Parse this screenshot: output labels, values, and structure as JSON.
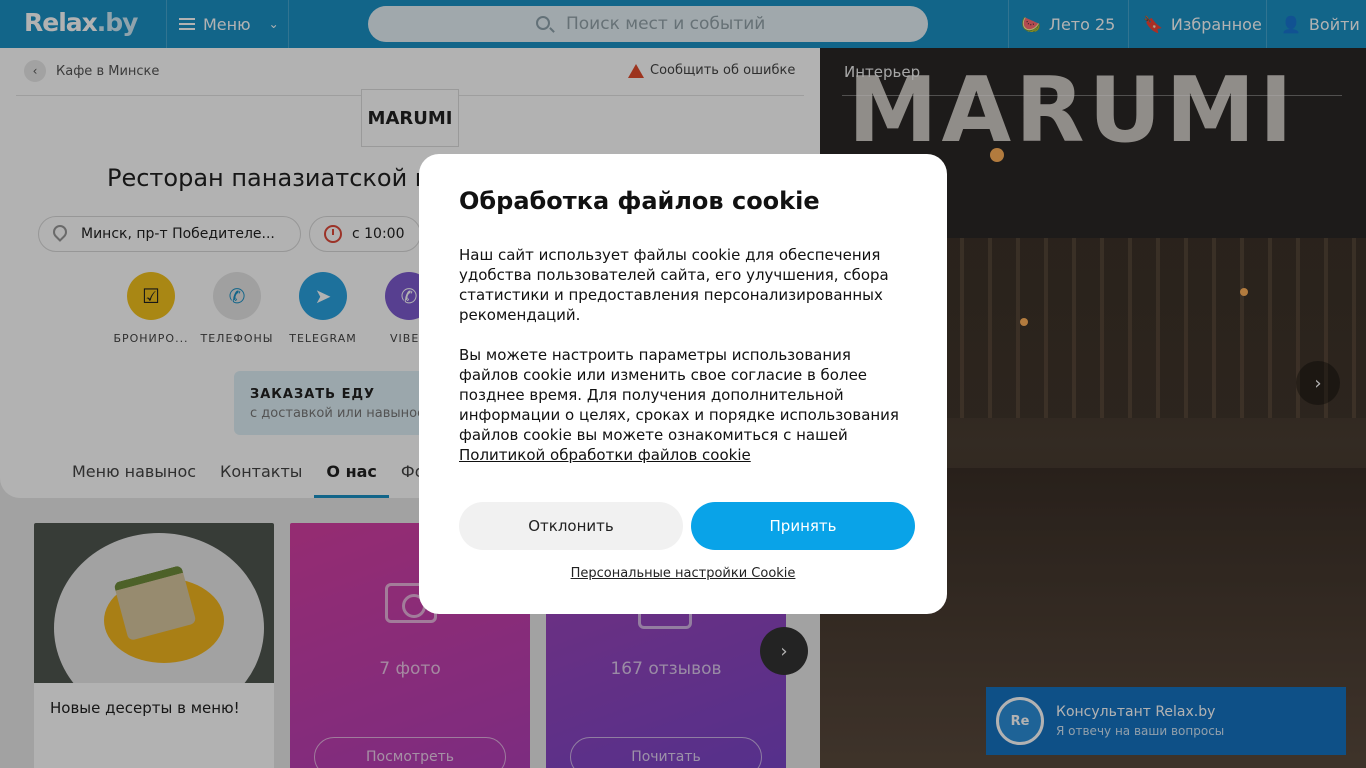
{
  "header": {
    "logo": "Relax",
    "logo_suffix": ".by",
    "menu_label": "Меню",
    "search_placeholder": "Поиск мест и событий",
    "summer_label": "Лето 25",
    "favorites_label": "Избранное",
    "login_label": "Войти"
  },
  "breadcrumb": {
    "label": "Кафе в Минске"
  },
  "report_label": "Сообщить об ошибке",
  "venue": {
    "logo_text": "MARUMI",
    "title": "Ресторан паназиатской кухни",
    "address": "Минск, пр-т Победителе...",
    "hours": "с 10:00"
  },
  "actions": [
    {
      "label": "БРОНИРО...",
      "icon": "calendar-check-icon",
      "color": "#f2c21e"
    },
    {
      "label": "ТЕЛЕФОНЫ",
      "icon": "phone-icon",
      "color": "#e6e6e6"
    },
    {
      "label": "TELEGRAM",
      "icon": "telegram-icon",
      "color": "#2aa3e0"
    },
    {
      "label": "VIBER",
      "icon": "viber-icon",
      "color": "#7d5bcf"
    }
  ],
  "order": {
    "title": "ЗАКАЗАТЬ ЕДУ",
    "subtitle": "с доставкой или навынос"
  },
  "tabs": [
    "Меню навынос",
    "Контакты",
    "О нас",
    "Фото"
  ],
  "active_tab": "О нас",
  "cards": {
    "news_text": "Новые десерты в меню!",
    "photo_count": "7 фото",
    "photo_button": "Посмотреть",
    "reviews_count": "167 отзывов",
    "reviews_button": "Почитать"
  },
  "interior": {
    "label": "Интерьер",
    "sign": "MARUMI"
  },
  "consultant": {
    "avatar": "Re",
    "title": "Консультант Relax.by",
    "subtitle": "Я отвечу на ваши вопросы"
  },
  "cookie": {
    "title": "Обработка файлов cookie",
    "para1": "Наш сайт использует файлы cookie для обеспечения удобства пользователей сайта, его улучшения, сбора статистики и предоставления персонализированных рекомендаций.",
    "para2": "Вы можете настроить параметры использования файлов cookie или изменить свое согласие в более позднее время. Для получения дополнительной информации о целях, сроках и порядке использования файлов cookie вы можете ознакомиться с нашей",
    "policy_link": "Политикой обработки файлов cookie",
    "decline": "Отклонить",
    "accept": "Принять",
    "personal": "Персональные настройки Cookie"
  },
  "colors": {
    "brand": "#1a91c5",
    "accept": "#09a3e8"
  }
}
